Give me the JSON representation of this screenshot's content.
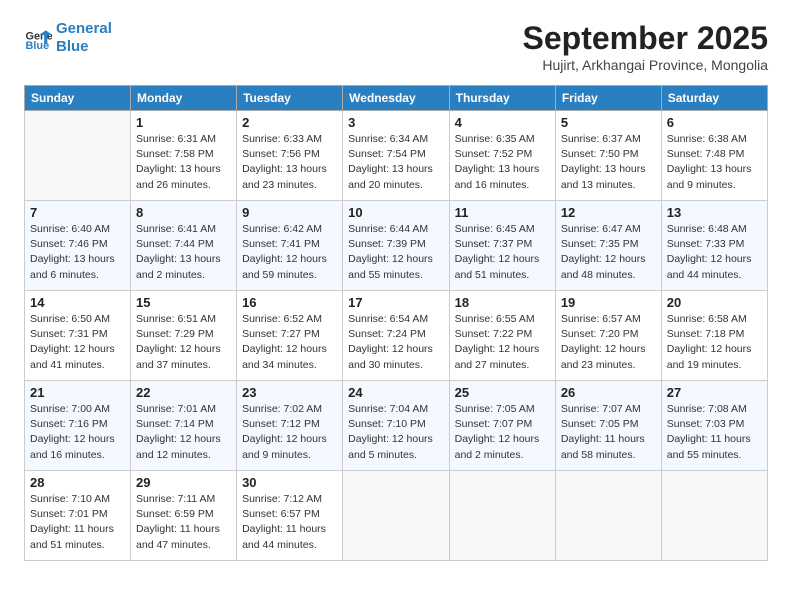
{
  "header": {
    "logo_line1": "General",
    "logo_line2": "Blue",
    "month": "September 2025",
    "location": "Hujirt, Arkhangai Province, Mongolia"
  },
  "days_of_week": [
    "Sunday",
    "Monday",
    "Tuesday",
    "Wednesday",
    "Thursday",
    "Friday",
    "Saturday"
  ],
  "weeks": [
    [
      {
        "day": "",
        "sunrise": "",
        "sunset": "",
        "daylight": ""
      },
      {
        "day": "1",
        "sunrise": "Sunrise: 6:31 AM",
        "sunset": "Sunset: 7:58 PM",
        "daylight": "Daylight: 13 hours and 26 minutes."
      },
      {
        "day": "2",
        "sunrise": "Sunrise: 6:33 AM",
        "sunset": "Sunset: 7:56 PM",
        "daylight": "Daylight: 13 hours and 23 minutes."
      },
      {
        "day": "3",
        "sunrise": "Sunrise: 6:34 AM",
        "sunset": "Sunset: 7:54 PM",
        "daylight": "Daylight: 13 hours and 20 minutes."
      },
      {
        "day": "4",
        "sunrise": "Sunrise: 6:35 AM",
        "sunset": "Sunset: 7:52 PM",
        "daylight": "Daylight: 13 hours and 16 minutes."
      },
      {
        "day": "5",
        "sunrise": "Sunrise: 6:37 AM",
        "sunset": "Sunset: 7:50 PM",
        "daylight": "Daylight: 13 hours and 13 minutes."
      },
      {
        "day": "6",
        "sunrise": "Sunrise: 6:38 AM",
        "sunset": "Sunset: 7:48 PM",
        "daylight": "Daylight: 13 hours and 9 minutes."
      }
    ],
    [
      {
        "day": "7",
        "sunrise": "Sunrise: 6:40 AM",
        "sunset": "Sunset: 7:46 PM",
        "daylight": "Daylight: 13 hours and 6 minutes."
      },
      {
        "day": "8",
        "sunrise": "Sunrise: 6:41 AM",
        "sunset": "Sunset: 7:44 PM",
        "daylight": "Daylight: 13 hours and 2 minutes."
      },
      {
        "day": "9",
        "sunrise": "Sunrise: 6:42 AM",
        "sunset": "Sunset: 7:41 PM",
        "daylight": "Daylight: 12 hours and 59 minutes."
      },
      {
        "day": "10",
        "sunrise": "Sunrise: 6:44 AM",
        "sunset": "Sunset: 7:39 PM",
        "daylight": "Daylight: 12 hours and 55 minutes."
      },
      {
        "day": "11",
        "sunrise": "Sunrise: 6:45 AM",
        "sunset": "Sunset: 7:37 PM",
        "daylight": "Daylight: 12 hours and 51 minutes."
      },
      {
        "day": "12",
        "sunrise": "Sunrise: 6:47 AM",
        "sunset": "Sunset: 7:35 PM",
        "daylight": "Daylight: 12 hours and 48 minutes."
      },
      {
        "day": "13",
        "sunrise": "Sunrise: 6:48 AM",
        "sunset": "Sunset: 7:33 PM",
        "daylight": "Daylight: 12 hours and 44 minutes."
      }
    ],
    [
      {
        "day": "14",
        "sunrise": "Sunrise: 6:50 AM",
        "sunset": "Sunset: 7:31 PM",
        "daylight": "Daylight: 12 hours and 41 minutes."
      },
      {
        "day": "15",
        "sunrise": "Sunrise: 6:51 AM",
        "sunset": "Sunset: 7:29 PM",
        "daylight": "Daylight: 12 hours and 37 minutes."
      },
      {
        "day": "16",
        "sunrise": "Sunrise: 6:52 AM",
        "sunset": "Sunset: 7:27 PM",
        "daylight": "Daylight: 12 hours and 34 minutes."
      },
      {
        "day": "17",
        "sunrise": "Sunrise: 6:54 AM",
        "sunset": "Sunset: 7:24 PM",
        "daylight": "Daylight: 12 hours and 30 minutes."
      },
      {
        "day": "18",
        "sunrise": "Sunrise: 6:55 AM",
        "sunset": "Sunset: 7:22 PM",
        "daylight": "Daylight: 12 hours and 27 minutes."
      },
      {
        "day": "19",
        "sunrise": "Sunrise: 6:57 AM",
        "sunset": "Sunset: 7:20 PM",
        "daylight": "Daylight: 12 hours and 23 minutes."
      },
      {
        "day": "20",
        "sunrise": "Sunrise: 6:58 AM",
        "sunset": "Sunset: 7:18 PM",
        "daylight": "Daylight: 12 hours and 19 minutes."
      }
    ],
    [
      {
        "day": "21",
        "sunrise": "Sunrise: 7:00 AM",
        "sunset": "Sunset: 7:16 PM",
        "daylight": "Daylight: 12 hours and 16 minutes."
      },
      {
        "day": "22",
        "sunrise": "Sunrise: 7:01 AM",
        "sunset": "Sunset: 7:14 PM",
        "daylight": "Daylight: 12 hours and 12 minutes."
      },
      {
        "day": "23",
        "sunrise": "Sunrise: 7:02 AM",
        "sunset": "Sunset: 7:12 PM",
        "daylight": "Daylight: 12 hours and 9 minutes."
      },
      {
        "day": "24",
        "sunrise": "Sunrise: 7:04 AM",
        "sunset": "Sunset: 7:10 PM",
        "daylight": "Daylight: 12 hours and 5 minutes."
      },
      {
        "day": "25",
        "sunrise": "Sunrise: 7:05 AM",
        "sunset": "Sunset: 7:07 PM",
        "daylight": "Daylight: 12 hours and 2 minutes."
      },
      {
        "day": "26",
        "sunrise": "Sunrise: 7:07 AM",
        "sunset": "Sunset: 7:05 PM",
        "daylight": "Daylight: 11 hours and 58 minutes."
      },
      {
        "day": "27",
        "sunrise": "Sunrise: 7:08 AM",
        "sunset": "Sunset: 7:03 PM",
        "daylight": "Daylight: 11 hours and 55 minutes."
      }
    ],
    [
      {
        "day": "28",
        "sunrise": "Sunrise: 7:10 AM",
        "sunset": "Sunset: 7:01 PM",
        "daylight": "Daylight: 11 hours and 51 minutes."
      },
      {
        "day": "29",
        "sunrise": "Sunrise: 7:11 AM",
        "sunset": "Sunset: 6:59 PM",
        "daylight": "Daylight: 11 hours and 47 minutes."
      },
      {
        "day": "30",
        "sunrise": "Sunrise: 7:12 AM",
        "sunset": "Sunset: 6:57 PM",
        "daylight": "Daylight: 11 hours and 44 minutes."
      },
      {
        "day": "",
        "sunrise": "",
        "sunset": "",
        "daylight": ""
      },
      {
        "day": "",
        "sunrise": "",
        "sunset": "",
        "daylight": ""
      },
      {
        "day": "",
        "sunrise": "",
        "sunset": "",
        "daylight": ""
      },
      {
        "day": "",
        "sunrise": "",
        "sunset": "",
        "daylight": ""
      }
    ]
  ]
}
